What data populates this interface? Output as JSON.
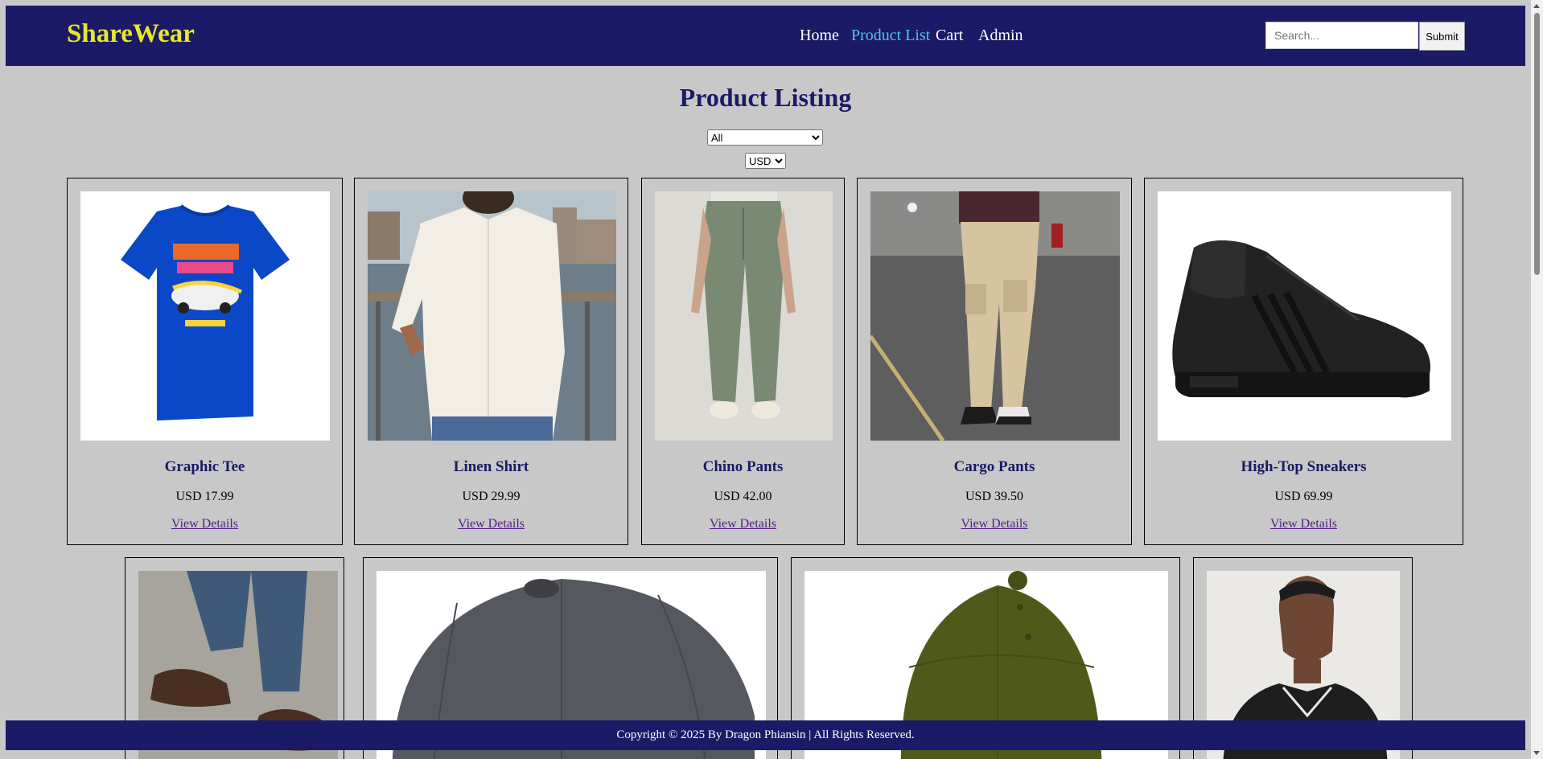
{
  "header": {
    "logo": "ShareWear",
    "nav": [
      "Home",
      "Product List",
      "Cart",
      "Admin"
    ],
    "active_nav": "Product List",
    "search_placeholder": "Search...",
    "submit_label": "Submit"
  },
  "main": {
    "title": "Product Listing",
    "category_filter": {
      "selected": "All"
    },
    "currency_filter": {
      "selected": "USD"
    }
  },
  "products": [
    {
      "name": "Graphic Tee",
      "price": "USD 17.99",
      "link": "View Details",
      "image": "blue-graphic-tshirt-photo"
    },
    {
      "name": "Linen Shirt",
      "price": "USD 29.99",
      "link": "View Details",
      "image": "white-linen-shirt-photo"
    },
    {
      "name": "Chino Pants",
      "price": "USD 42.00",
      "link": "View Details",
      "image": "sage-chino-pants-photo"
    },
    {
      "name": "Cargo Pants",
      "price": "USD 39.50",
      "link": "View Details",
      "image": "beige-cargo-pants-photo"
    },
    {
      "name": "High-Top Sneakers",
      "price": "USD 69.99",
      "link": "View Details",
      "image": "black-high-top-sneaker-photo"
    }
  ],
  "second_row": [
    {
      "image": "loafers-jeans-photo"
    },
    {
      "image": "grey-flat-cap-photo"
    },
    {
      "image": "olive-cap-photo"
    },
    {
      "image": "black-jacket-model-photo"
    }
  ],
  "colors": {
    "navbar": "#1a1a66",
    "logo": "#e8e82a",
    "active_nav": "#4fc3e6",
    "page_bg": "#c8c8c8",
    "product_name": "#1a1a66"
  },
  "footer": {
    "text": "Copyright © 2025 By Dragon Phiansin | All Rights Reserved."
  }
}
